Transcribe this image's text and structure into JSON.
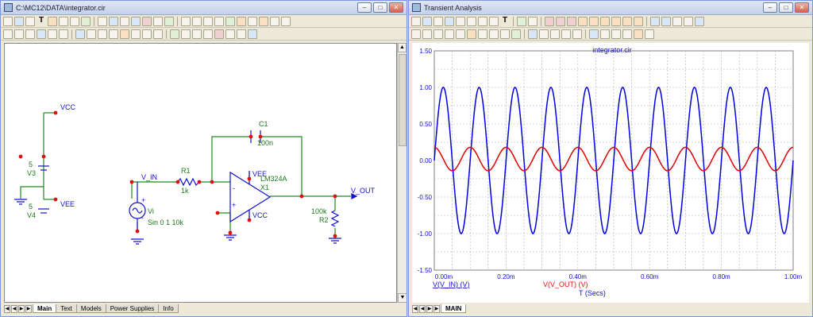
{
  "schematic_window": {
    "title": "C:\\MC12\\DATA\\integrator.cir",
    "tabs": [
      "Main",
      "Text",
      "Models",
      "Power Supplies",
      "Info"
    ],
    "components": {
      "vcc_top": "VCC",
      "v3_value": "5",
      "v3_name": "V3",
      "v4_value": "5",
      "v4_name": "V4",
      "vee_bottom": "VEE",
      "v_in": "V_IN",
      "r1_name": "R1",
      "r1_value": "1k",
      "vi_name": "Vi",
      "vi_value": "Sin 0 1 10k",
      "c1_name": "C1",
      "c1_value": "100n",
      "opamp_vee": "VEE",
      "opamp_model": "LM324A",
      "opamp_name": "X1",
      "opamp_vcc": "VCC",
      "v_out": "V_OUT",
      "r2_value": "100k",
      "r2_name": "R2",
      "plus": "+",
      "minus": "-"
    }
  },
  "analysis_window": {
    "title": "Transient Analysis",
    "tabs": [
      "MAIN"
    ]
  },
  "chart_data": {
    "type": "line",
    "title": "integrator.cir",
    "xlabel": "T (Secs)",
    "xlim": [
      0,
      1.0
    ],
    "ylim": [
      -1.5,
      1.5
    ],
    "x_ticks": [
      "0.00m",
      "0.20m",
      "0.40m",
      "0.60m",
      "0.80m",
      "1.00m"
    ],
    "x_tick_values": [
      0,
      0.2,
      0.4,
      0.6,
      0.8,
      1.0
    ],
    "y_ticks": [
      "1.50",
      "1.00",
      "0.50",
      "0.00",
      "-0.50",
      "-1.00",
      "-1.50"
    ],
    "y_tick_values": [
      1.5,
      1.0,
      0.5,
      0.0,
      -0.5,
      -1.0,
      -1.5
    ],
    "grid": true,
    "series": [
      {
        "name": "V(V_IN) (V)",
        "color": "#0000e0",
        "function": "sine",
        "amplitude": 1.0,
        "frequency_per_ms": 10,
        "phase_deg": 0,
        "offset": 0
      },
      {
        "name": "V(V_OUT) (V)",
        "color": "#e00000",
        "function": "sine",
        "amplitude": 0.16,
        "frequency_per_ms": 10,
        "phase_deg": 90,
        "offset": 0.02
      }
    ]
  }
}
